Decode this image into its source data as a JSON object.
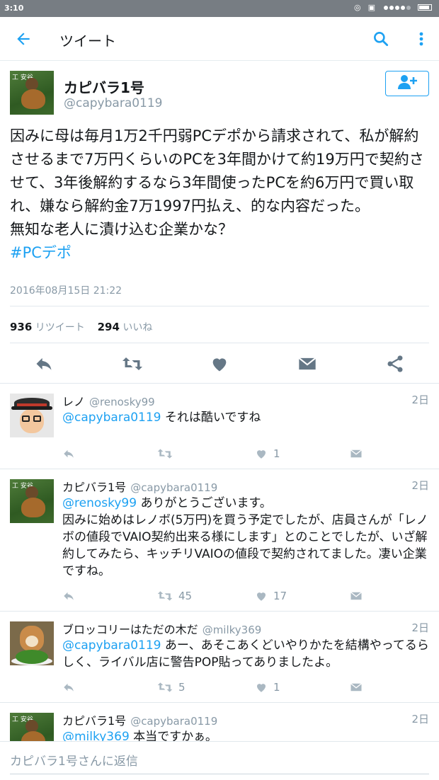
{
  "status_bar": {
    "time": "3:10"
  },
  "app_bar": {
    "title": "ツイート"
  },
  "main_tweet": {
    "display_name": "カピバラ1号",
    "handle": "@capybara0119",
    "text": "因みに母は毎月1万2千円弱PCデポから請求されて、私が解約させるまで7万円くらいのPCを3年間かけて約19万円で契約させて、3年後解約するなら3年間使ったPCを約6万円で買い取れ、嫌なら解約金7万1997円払え、的な内容だった。\n無知な老人に漬け込む企業かな？",
    "hashtag": "#PCデポ",
    "timestamp": "2016年08月15日 21:22",
    "retweet_count": "936",
    "retweet_label": "リツイート",
    "like_count": "294",
    "like_label": "いいね"
  },
  "replies": [
    {
      "display_name": "レノ",
      "handle": "@renosky99",
      "time": "2日",
      "mention": "@capybara0119",
      "text": " それは酷いですね",
      "retweets": "",
      "likes": "1"
    },
    {
      "display_name": "カピバラ1号",
      "handle": "@capybara0119",
      "time": "2日",
      "mention": "@renosky99",
      "text": " ありがとうございます。\n因みに始めはレノボ(5万円)を買う予定でしたが、店員さんが「レノボの値段でVAIO契約出来る様にします」とのことでしたが、いざ解約してみたら、キッチリVAIOの値段で契約されてました。凄い企業ですね。",
      "retweets": "45",
      "likes": "17"
    },
    {
      "display_name": "ブロッコリーはただの木だ",
      "handle": "@milky369",
      "time": "2日",
      "mention": "@capybara0119",
      "text": " あー、あそこあくどいやりかたを結構やってるらしく、ライバル店に警告POP貼ってありましたよ。",
      "retweets": "5",
      "likes": "1"
    },
    {
      "display_name": "カピバラ1号",
      "handle": "@capybara0119",
      "time": "2日",
      "mention": "@milky369",
      "text": " 本当ですかぁ。"
    }
  ],
  "reply_input": {
    "placeholder": "カピバラ1号さんに返信"
  },
  "colors": {
    "accent": "#1da1f2",
    "muted": "#8899a6",
    "text": "#14171a"
  },
  "icons": [
    "back-arrow-icon",
    "search-icon",
    "more-vert-icon",
    "follow-user-icon",
    "reply-icon",
    "retweet-icon",
    "like-icon",
    "dm-icon",
    "share-icon"
  ]
}
